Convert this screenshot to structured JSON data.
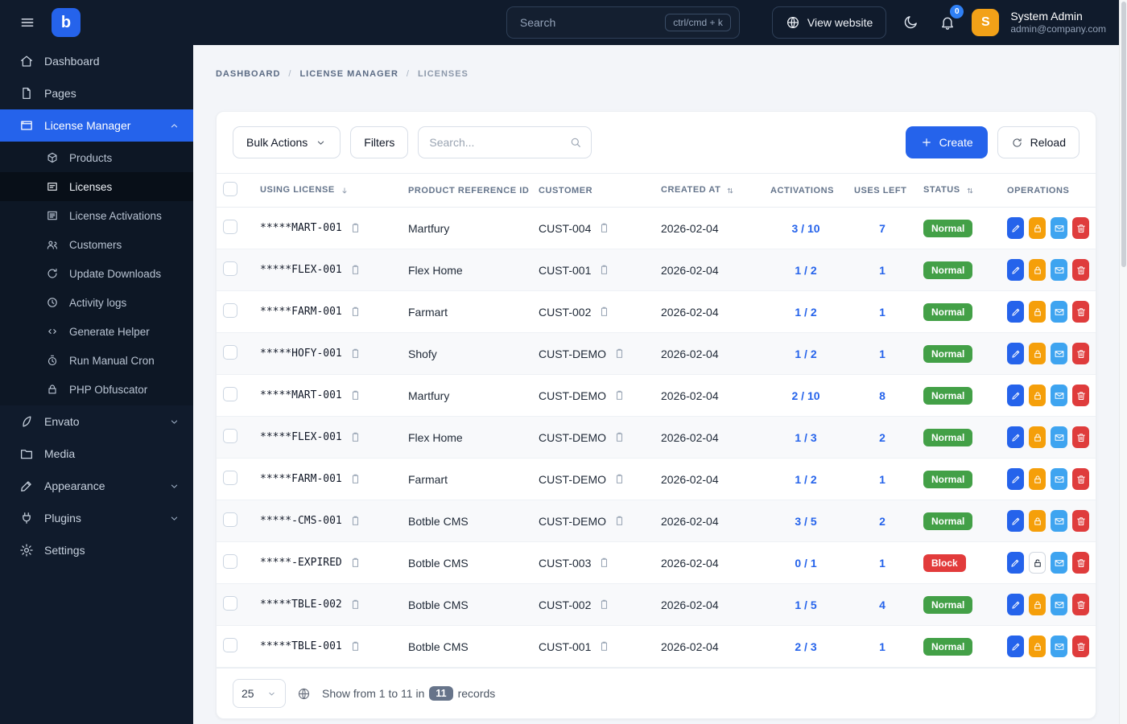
{
  "topbar": {
    "logo_letter": "b",
    "search_placeholder": "Search",
    "search_shortcut": "ctrl/cmd + k",
    "view_website": "View website",
    "notification_count": "0",
    "user": {
      "name": "System Admin",
      "email": "admin@company.com",
      "avatar_initial": "S"
    }
  },
  "sidebar": {
    "items": [
      {
        "label": "Dashboard",
        "icon": "home-icon"
      },
      {
        "label": "Pages",
        "icon": "pages-icon"
      },
      {
        "label": "License Manager",
        "icon": "license-manager-icon",
        "active": true,
        "expanded": true,
        "children": [
          {
            "label": "Products",
            "icon": "products-icon"
          },
          {
            "label": "Licenses",
            "icon": "licenses-icon",
            "selected": true
          },
          {
            "label": "License Activations",
            "icon": "activations-icon"
          },
          {
            "label": "Customers",
            "icon": "customers-icon"
          },
          {
            "label": "Update Downloads",
            "icon": "update-icon"
          },
          {
            "label": "Activity logs",
            "icon": "activity-icon"
          },
          {
            "label": "Generate Helper",
            "icon": "code-icon"
          },
          {
            "label": "Run Manual Cron",
            "icon": "cron-icon"
          },
          {
            "label": "PHP Obfuscator",
            "icon": "obfuscator-icon"
          }
        ]
      },
      {
        "label": "Envato",
        "icon": "envato-icon",
        "chevron": true
      },
      {
        "label": "Media",
        "icon": "media-icon"
      },
      {
        "label": "Appearance",
        "icon": "appearance-icon",
        "chevron": true
      },
      {
        "label": "Plugins",
        "icon": "plugins-icon",
        "chevron": true
      },
      {
        "label": "Settings",
        "icon": "settings-icon"
      }
    ]
  },
  "breadcrumb": [
    "DASHBOARD",
    "LICENSE MANAGER",
    "LICENSES"
  ],
  "toolbar": {
    "bulk_actions": "Bulk Actions",
    "filters": "Filters",
    "search_placeholder": "Search...",
    "create": "Create",
    "reload": "Reload"
  },
  "table": {
    "columns": [
      {
        "label": "USING LICENSE",
        "sort": "desc"
      },
      {
        "label": "PRODUCT REFERENCE ID"
      },
      {
        "label": "CUSTOMER"
      },
      {
        "label": "CREATED AT",
        "sort": "both"
      },
      {
        "label": "ACTIVATIONS"
      },
      {
        "label": "USES LEFT"
      },
      {
        "label": "STATUS",
        "sort": "both"
      },
      {
        "label": "OPERATIONS"
      }
    ],
    "rows": [
      {
        "license": "*****MART-001",
        "product": "Martfury",
        "customer": "CUST-004",
        "created_at": "2026-02-04",
        "activations": "3 / 10",
        "uses_left": "7",
        "status": "Normal",
        "locked": true
      },
      {
        "license": "*****FLEX-001",
        "product": "Flex Home",
        "customer": "CUST-001",
        "created_at": "2026-02-04",
        "activations": "1 / 2",
        "uses_left": "1",
        "status": "Normal",
        "locked": true
      },
      {
        "license": "*****FARM-001",
        "product": "Farmart",
        "customer": "CUST-002",
        "created_at": "2026-02-04",
        "activations": "1 / 2",
        "uses_left": "1",
        "status": "Normal",
        "locked": true
      },
      {
        "license": "*****HOFY-001",
        "product": "Shofy",
        "customer": "CUST-DEMO",
        "created_at": "2026-02-04",
        "activations": "1 / 2",
        "uses_left": "1",
        "status": "Normal",
        "locked": true
      },
      {
        "license": "*****MART-001",
        "product": "Martfury",
        "customer": "CUST-DEMO",
        "created_at": "2026-02-04",
        "activations": "2 / 10",
        "uses_left": "8",
        "status": "Normal",
        "locked": true
      },
      {
        "license": "*****FLEX-001",
        "product": "Flex Home",
        "customer": "CUST-DEMO",
        "created_at": "2026-02-04",
        "activations": "1 / 3",
        "uses_left": "2",
        "status": "Normal",
        "locked": true
      },
      {
        "license": "*****FARM-001",
        "product": "Farmart",
        "customer": "CUST-DEMO",
        "created_at": "2026-02-04",
        "activations": "1 / 2",
        "uses_left": "1",
        "status": "Normal",
        "locked": true
      },
      {
        "license": "*****-CMS-001",
        "product": "Botble CMS",
        "customer": "CUST-DEMO",
        "created_at": "2026-02-04",
        "activations": "3 / 5",
        "uses_left": "2",
        "status": "Normal",
        "locked": true
      },
      {
        "license": "*****-EXPIRED",
        "product": "Botble CMS",
        "customer": "CUST-003",
        "created_at": "2026-02-04",
        "activations": "0 / 1",
        "uses_left": "1",
        "status": "Block",
        "locked": false
      },
      {
        "license": "*****TBLE-002",
        "product": "Botble CMS",
        "customer": "CUST-002",
        "created_at": "2026-02-04",
        "activations": "1 / 5",
        "uses_left": "4",
        "status": "Normal",
        "locked": true
      },
      {
        "license": "*****TBLE-001",
        "product": "Botble CMS",
        "customer": "CUST-001",
        "created_at": "2026-02-04",
        "activations": "2 / 3",
        "uses_left": "1",
        "status": "Normal",
        "locked": true
      }
    ]
  },
  "footer": {
    "page_size": "25",
    "summary_prefix": "Show from 1 to 11 in",
    "records_count": "11",
    "summary_suffix": "records"
  },
  "colors": {
    "topbar_bg": "#101b2c",
    "accent_blue": "#2563eb",
    "status_normal": "#43a047",
    "status_block": "#e23b3b",
    "lock_amber": "#f59f0a",
    "mail_blue": "#3ea4f0",
    "delete_red": "#df3c3c",
    "avatar_orange": "#f2a118"
  }
}
